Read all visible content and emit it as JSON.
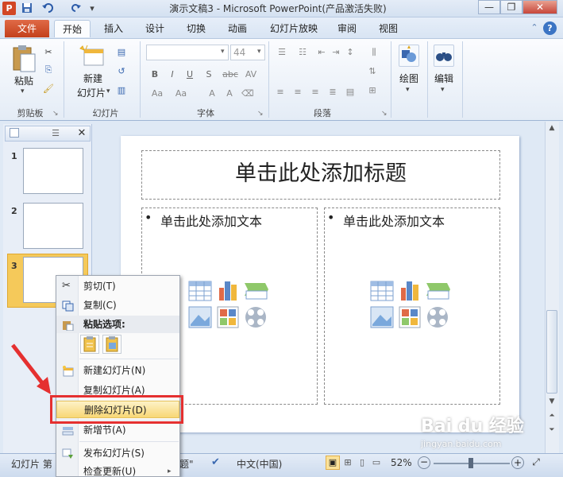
{
  "window": {
    "title": "演示文稿3 - Microsoft PowerPoint(产品激活失败)",
    "minimize": "—",
    "restore": "❐",
    "close": "✕"
  },
  "qat": {
    "app_icon": "P",
    "save_icon": "save-icon",
    "undo_icon": "undo-icon",
    "redo_icon": "redo-icon"
  },
  "tabs": {
    "file": "文件",
    "items": [
      "开始",
      "插入",
      "设计",
      "切换",
      "动画",
      "幻灯片放映",
      "审阅",
      "视图"
    ],
    "active": "开始"
  },
  "ribbon": {
    "clipboard": {
      "paste": "粘贴",
      "group": "剪贴板"
    },
    "slides": {
      "new_slide_line1": "新建",
      "new_slide_line2": "幻灯片",
      "group": "幻灯片"
    },
    "font": {
      "size_placeholder": "44",
      "group": "字体"
    },
    "paragraph": {
      "group": "段落"
    },
    "drawing": {
      "label": "绘图"
    },
    "editing": {
      "label": "编辑"
    }
  },
  "thumbnails": [
    {
      "num": "1"
    },
    {
      "num": "2"
    },
    {
      "num": "3"
    }
  ],
  "slide": {
    "title_placeholder": "单击此处添加标题",
    "body_left": "单击此处添加文本",
    "body_right": "单击此处添加文本",
    "bullet": "•"
  },
  "context_menu": {
    "cut": "剪切(T)",
    "copy": "复制(C)",
    "paste_options": "粘贴选项:",
    "new_slide": "新建幻灯片(N)",
    "duplicate_slide": "复制幻灯片(A)",
    "delete_slide": "删除幻灯片(D)",
    "new_section": "新增节(A)",
    "publish_slides": "发布幻灯片(S)",
    "check_updates": "检查更新(U)"
  },
  "statusbar": {
    "slide_info": "幻灯片 第",
    "theme": "题\"",
    "language": "中文(中国)",
    "zoom": "52%"
  },
  "watermark": {
    "text": "Bai du 经验",
    "url": "jingyan.baidu.com"
  },
  "colors": {
    "file_tab": "#c3401c",
    "highlight": "#e53030",
    "selected_thumb": "#f5c95a"
  }
}
